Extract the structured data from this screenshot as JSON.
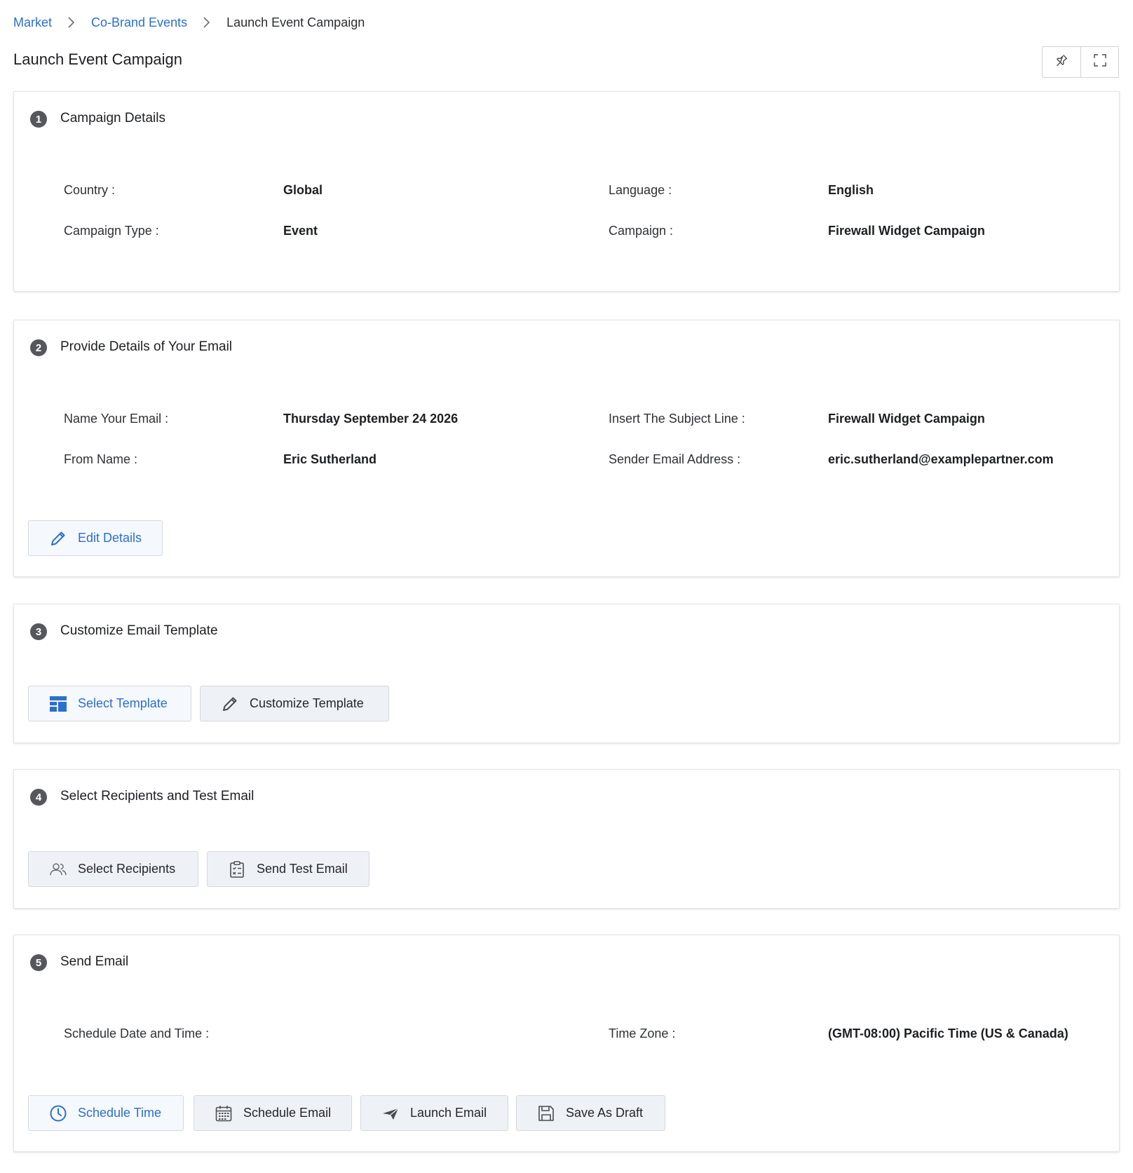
{
  "breadcrumb": {
    "items": [
      "Market",
      "Co-Brand Events"
    ],
    "current": "Launch Event Campaign"
  },
  "page": {
    "title": "Launch Event Campaign"
  },
  "colors": {
    "link": "#2c6fcf",
    "step_badge": "#55575c",
    "button_bg": "#eef1f5"
  },
  "sections": {
    "campaign_details": {
      "number": "1",
      "title": "Campaign Details",
      "country_label": "Country :",
      "country_value": "Global",
      "language_label": "Language :",
      "language_value": "English",
      "campaign_type_label": "Campaign Type :",
      "campaign_type_value": "Event",
      "campaign_label": "Campaign :",
      "campaign_value": "Firewall Widget Campaign"
    },
    "email_details": {
      "number": "2",
      "title": "Provide Details of Your Email",
      "name_label": "Name Your Email :",
      "name_value": "Thursday September 24 2026",
      "subject_label": "Insert The Subject Line :",
      "subject_value": "Firewall Widget Campaign",
      "from_label": "From Name :",
      "from_value": "Eric Sutherland",
      "sender_label": "Sender Email Address :",
      "sender_value": "eric.sutherland@examplepartner.com",
      "edit_button": "Edit Details"
    },
    "template": {
      "number": "3",
      "title": "Customize Email Template",
      "select_button": "Select Template",
      "customize_button": "Customize Template"
    },
    "recipients": {
      "number": "4",
      "title": "Select Recipients and Test Email",
      "select_button": "Select Recipients",
      "test_button": "Send Test Email"
    },
    "send": {
      "number": "5",
      "title": "Send Email",
      "schedule_label": "Schedule Date and Time :",
      "timezone_label": "Time Zone :",
      "timezone_value": "(GMT-08:00) Pacific Time (US & Canada)",
      "schedule_time_button": "Schedule Time",
      "schedule_email_button": "Schedule Email",
      "launch_button": "Launch Email",
      "draft_button": "Save As Draft"
    }
  }
}
